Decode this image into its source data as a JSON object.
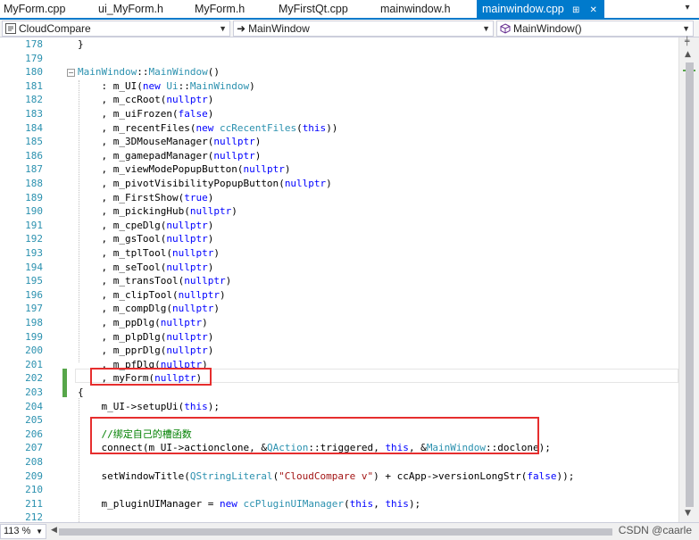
{
  "tabs": [
    {
      "label": "MyForm.cpp",
      "active": false
    },
    {
      "label": "ui_MyForm.h",
      "active": false
    },
    {
      "label": "MyForm.h",
      "active": false
    },
    {
      "label": "MyFirstQt.cpp",
      "active": false
    },
    {
      "label": "mainwindow.h",
      "active": false
    },
    {
      "label": "mainwindow.cpp",
      "active": true
    }
  ],
  "navbar": {
    "project": "CloudCompare",
    "scope": "MainWindow",
    "member": "MainWindow()"
  },
  "editor": {
    "zoom": "113 %",
    "lines": [
      {
        "n": "178",
        "code": "}"
      },
      {
        "n": "179",
        "code": ""
      },
      {
        "n": "180",
        "code": "MainWindow::MainWindow()"
      },
      {
        "n": "181",
        "code": "    : m_UI(new Ui::MainWindow)"
      },
      {
        "n": "182",
        "code": "    , m_ccRoot(nullptr)"
      },
      {
        "n": "183",
        "code": "    , m_uiFrozen(false)"
      },
      {
        "n": "184",
        "code": "    , m_recentFiles(new ccRecentFiles(this))"
      },
      {
        "n": "185",
        "code": "    , m_3DMouseManager(nullptr)"
      },
      {
        "n": "186",
        "code": "    , m_gamepadManager(nullptr)"
      },
      {
        "n": "187",
        "code": "    , m_viewModePopupButton(nullptr)"
      },
      {
        "n": "188",
        "code": "    , m_pivotVisibilityPopupButton(nullptr)"
      },
      {
        "n": "189",
        "code": "    , m_FirstShow(true)"
      },
      {
        "n": "190",
        "code": "    , m_pickingHub(nullptr)"
      },
      {
        "n": "191",
        "code": "    , m_cpeDlg(nullptr)"
      },
      {
        "n": "192",
        "code": "    , m_gsTool(nullptr)"
      },
      {
        "n": "193",
        "code": "    , m_tplTool(nullptr)"
      },
      {
        "n": "194",
        "code": "    , m_seTool(nullptr)"
      },
      {
        "n": "195",
        "code": "    , m_transTool(nullptr)"
      },
      {
        "n": "196",
        "code": "    , m_clipTool(nullptr)"
      },
      {
        "n": "197",
        "code": "    , m_compDlg(nullptr)"
      },
      {
        "n": "198",
        "code": "    , m_ppDlg(nullptr)"
      },
      {
        "n": "199",
        "code": "    , m_plpDlg(nullptr)"
      },
      {
        "n": "200",
        "code": "    , m_pprDlg(nullptr)"
      },
      {
        "n": "201",
        "code": "    , m_pfDlg(nullptr)"
      },
      {
        "n": "202",
        "code": "    , myForm(nullptr)"
      },
      {
        "n": "203",
        "code": "{"
      },
      {
        "n": "204",
        "code": "    m_UI->setupUi(this);"
      },
      {
        "n": "205",
        "code": ""
      },
      {
        "n": "206",
        "code": "    //绑定自己的槽函数"
      },
      {
        "n": "207",
        "code": "    connect(m_UI->actionclone, &QAction::triggered, this, &MainWindow::doclone);"
      },
      {
        "n": "208",
        "code": ""
      },
      {
        "n": "209",
        "code": "    setWindowTitle(QStringLiteral(\"CloudCompare v\") + ccApp->versionLongStr(false));"
      },
      {
        "n": "210",
        "code": ""
      },
      {
        "n": "211",
        "code": "    m_pluginUIManager = new ccPluginUIManager(this, this);"
      },
      {
        "n": "212",
        "code": ""
      }
    ]
  },
  "watermark": "CSDN @caarle",
  "colors": {
    "accent": "#007acc",
    "line_number": "#2b91af",
    "keyword": "#0000ff",
    "type": "#2b91af",
    "string": "#a31515",
    "comment": "#008000",
    "highlight_box": "#e62e2e",
    "change_bar": "#57a64a"
  }
}
